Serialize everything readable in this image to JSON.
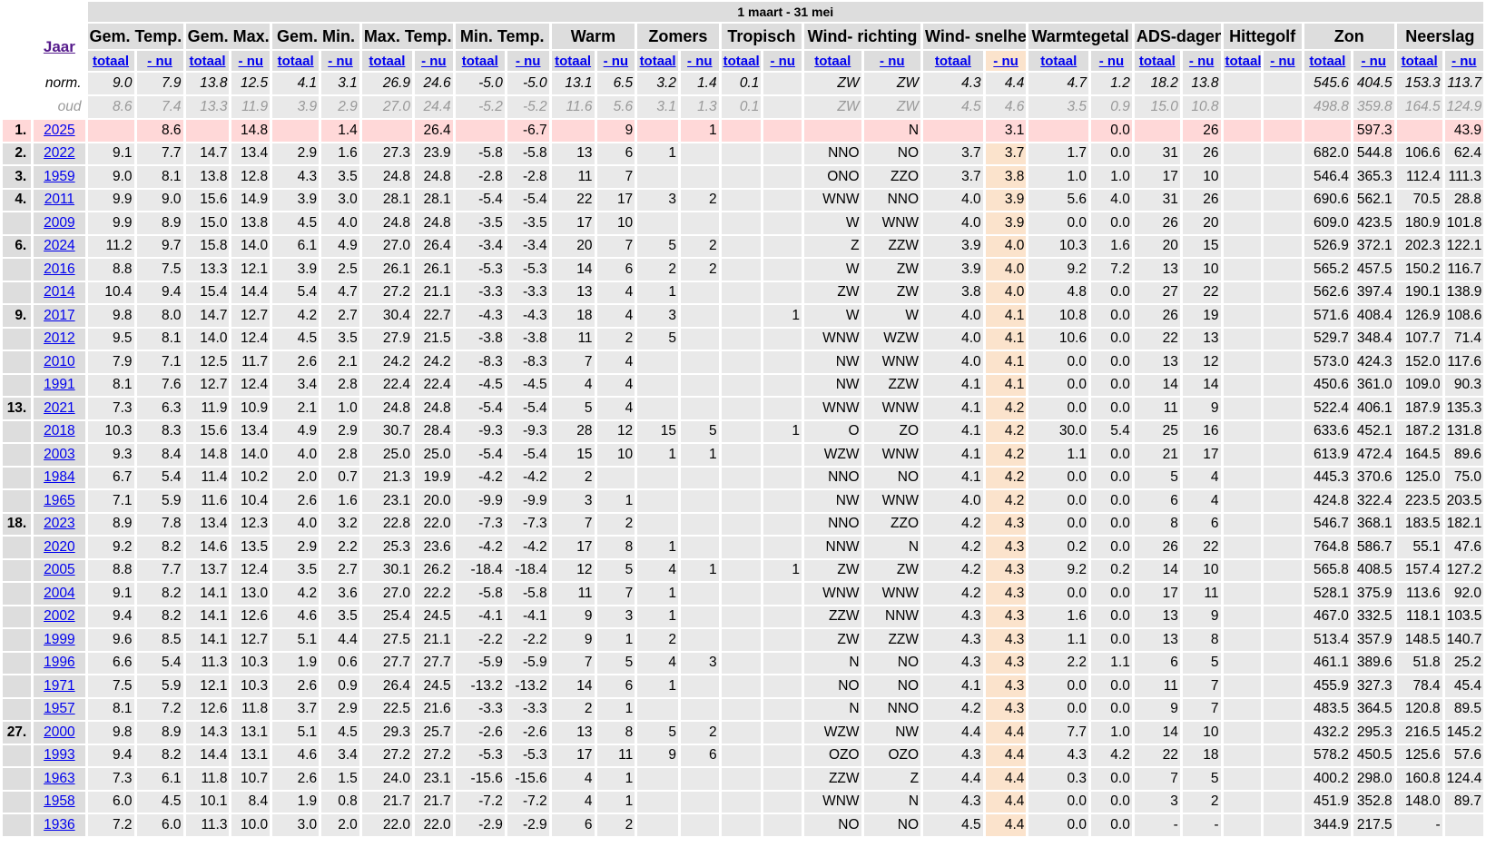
{
  "period": "1 maart - 31 mei",
  "jaar_label": "Jaar",
  "groups": [
    "Gem. Temp.",
    "Gem. Max.",
    "Gem. Min.",
    "Max. Temp.",
    "Min. Temp.",
    "Warm",
    "Zomers",
    "Tropisch",
    "Wind- richting",
    "Wind- snelheid",
    "Warmtegetal",
    "ADS-dagen",
    "Hittegolf",
    "Zon",
    "Neerslag"
  ],
  "sub_labels": [
    "totaal",
    "- nu"
  ],
  "highlight_col": 19,
  "norm": {
    "label": "norm.",
    "values": [
      "9.0",
      "7.9",
      "13.8",
      "12.5",
      "4.1",
      "3.1",
      "26.9",
      "24.6",
      "-5.0",
      "-5.0",
      "13.1",
      "6.5",
      "3.2",
      "1.4",
      "0.1",
      "",
      "ZW",
      "ZW",
      "4.3",
      "4.4",
      "4.7",
      "1.2",
      "18.2",
      "13.8",
      "",
      "",
      "545.6",
      "404.5",
      "153.3",
      "113.7"
    ]
  },
  "oud": {
    "label": "oud",
    "values": [
      "8.6",
      "7.4",
      "13.3",
      "11.9",
      "3.9",
      "2.9",
      "27.0",
      "24.4",
      "-5.2",
      "-5.2",
      "11.6",
      "5.6",
      "3.1",
      "1.3",
      "0.1",
      "",
      "ZW",
      "ZW",
      "4.5",
      "4.6",
      "3.5",
      "0.9",
      "15.0",
      "10.8",
      "",
      "",
      "498.8",
      "359.8",
      "164.5",
      "124.9"
    ]
  },
  "rows": [
    {
      "rank": "1.",
      "year": "2025",
      "current": true,
      "values": [
        "",
        "8.6",
        "",
        "14.8",
        "",
        "1.4",
        "",
        "26.4",
        "",
        "-6.7",
        "",
        "9",
        "",
        "1",
        "",
        "",
        "",
        "N",
        "",
        "3.1",
        "",
        "0.0",
        "",
        "26",
        "",
        "",
        "",
        "597.3",
        "",
        "43.9"
      ]
    },
    {
      "rank": "2.",
      "year": "2022",
      "values": [
        "9.1",
        "7.7",
        "14.7",
        "13.4",
        "2.9",
        "1.6",
        "27.3",
        "23.9",
        "-5.8",
        "-5.8",
        "13",
        "6",
        "1",
        "",
        "",
        "",
        "NNO",
        "NO",
        "3.7",
        "3.7",
        "1.7",
        "0.0",
        "31",
        "26",
        "",
        "",
        "682.0",
        "544.8",
        "106.6",
        "62.4"
      ]
    },
    {
      "rank": "3.",
      "year": "1959",
      "values": [
        "9.0",
        "8.1",
        "13.8",
        "12.8",
        "4.3",
        "3.5",
        "24.8",
        "24.8",
        "-2.8",
        "-2.8",
        "11",
        "7",
        "",
        "",
        "",
        "",
        "ONO",
        "ZZO",
        "3.7",
        "3.8",
        "1.0",
        "1.0",
        "17",
        "10",
        "",
        "",
        "546.4",
        "365.3",
        "112.4",
        "111.3"
      ]
    },
    {
      "rank": "4.",
      "year": "2011",
      "values": [
        "9.9",
        "9.0",
        "15.6",
        "14.9",
        "3.9",
        "3.0",
        "28.1",
        "28.1",
        "-5.4",
        "-5.4",
        "22",
        "17",
        "3",
        "2",
        "",
        "",
        "WNW",
        "NNO",
        "4.0",
        "3.9",
        "5.6",
        "4.0",
        "31",
        "26",
        "",
        "",
        "690.6",
        "562.1",
        "70.5",
        "28.8"
      ]
    },
    {
      "rank": "",
      "year": "2009",
      "values": [
        "9.9",
        "8.9",
        "15.0",
        "13.8",
        "4.5",
        "4.0",
        "24.8",
        "24.8",
        "-3.5",
        "-3.5",
        "17",
        "10",
        "",
        "",
        "",
        "",
        "W",
        "WNW",
        "4.0",
        "3.9",
        "0.0",
        "0.0",
        "26",
        "20",
        "",
        "",
        "609.0",
        "423.5",
        "180.9",
        "101.8"
      ]
    },
    {
      "rank": "6.",
      "year": "2024",
      "values": [
        "11.2",
        "9.7",
        "15.8",
        "14.0",
        "6.1",
        "4.9",
        "27.0",
        "26.4",
        "-3.4",
        "-3.4",
        "20",
        "7",
        "5",
        "2",
        "",
        "",
        "Z",
        "ZZW",
        "3.9",
        "4.0",
        "10.3",
        "1.6",
        "20",
        "15",
        "",
        "",
        "526.9",
        "372.1",
        "202.3",
        "122.1"
      ]
    },
    {
      "rank": "",
      "year": "2016",
      "values": [
        "8.8",
        "7.5",
        "13.3",
        "12.1",
        "3.9",
        "2.5",
        "26.1",
        "26.1",
        "-5.3",
        "-5.3",
        "14",
        "6",
        "2",
        "2",
        "",
        "",
        "W",
        "ZW",
        "3.9",
        "4.0",
        "9.2",
        "7.2",
        "13",
        "10",
        "",
        "",
        "565.2",
        "457.5",
        "150.2",
        "116.7"
      ]
    },
    {
      "rank": "",
      "year": "2014",
      "values": [
        "10.4",
        "9.4",
        "15.4",
        "14.4",
        "5.4",
        "4.7",
        "27.2",
        "21.1",
        "-3.3",
        "-3.3",
        "13",
        "4",
        "1",
        "",
        "",
        "",
        "ZW",
        "ZW",
        "3.8",
        "4.0",
        "4.8",
        "0.0",
        "27",
        "22",
        "",
        "",
        "562.6",
        "397.4",
        "190.1",
        "138.9"
      ]
    },
    {
      "rank": "9.",
      "year": "2017",
      "values": [
        "9.8",
        "8.0",
        "14.7",
        "12.7",
        "4.2",
        "2.7",
        "30.4",
        "22.7",
        "-4.3",
        "-4.3",
        "18",
        "4",
        "3",
        "",
        "",
        "1",
        "W",
        "W",
        "4.0",
        "4.1",
        "10.8",
        "0.0",
        "26",
        "19",
        "",
        "",
        "571.6",
        "408.4",
        "126.9",
        "108.6"
      ]
    },
    {
      "rank": "",
      "year": "2012",
      "values": [
        "9.5",
        "8.1",
        "14.0",
        "12.4",
        "4.5",
        "3.5",
        "27.9",
        "21.5",
        "-3.8",
        "-3.8",
        "11",
        "2",
        "5",
        "",
        "",
        "",
        "WNW",
        "WZW",
        "4.0",
        "4.1",
        "10.6",
        "0.0",
        "22",
        "13",
        "",
        "",
        "529.7",
        "348.4",
        "107.7",
        "71.4"
      ]
    },
    {
      "rank": "",
      "year": "2010",
      "values": [
        "7.9",
        "7.1",
        "12.5",
        "11.7",
        "2.6",
        "2.1",
        "24.2",
        "24.2",
        "-8.3",
        "-8.3",
        "7",
        "4",
        "",
        "",
        "",
        "",
        "NW",
        "WNW",
        "4.0",
        "4.1",
        "0.0",
        "0.0",
        "13",
        "12",
        "",
        "",
        "573.0",
        "424.3",
        "152.0",
        "117.6"
      ]
    },
    {
      "rank": "",
      "year": "1991",
      "values": [
        "8.1",
        "7.6",
        "12.7",
        "12.4",
        "3.4",
        "2.8",
        "22.4",
        "22.4",
        "-4.5",
        "-4.5",
        "4",
        "4",
        "",
        "",
        "",
        "",
        "NW",
        "ZZW",
        "4.1",
        "4.1",
        "0.0",
        "0.0",
        "14",
        "14",
        "",
        "",
        "450.6",
        "361.0",
        "109.0",
        "90.3"
      ]
    },
    {
      "rank": "13.",
      "year": "2021",
      "values": [
        "7.3",
        "6.3",
        "11.9",
        "10.9",
        "2.1",
        "1.0",
        "24.8",
        "24.8",
        "-5.4",
        "-5.4",
        "5",
        "4",
        "",
        "",
        "",
        "",
        "WNW",
        "WNW",
        "4.1",
        "4.2",
        "0.0",
        "0.0",
        "11",
        "9",
        "",
        "",
        "522.4",
        "406.1",
        "187.9",
        "135.3"
      ]
    },
    {
      "rank": "",
      "year": "2018",
      "values": [
        "10.3",
        "8.3",
        "15.6",
        "13.4",
        "4.9",
        "2.9",
        "30.7",
        "28.4",
        "-9.3",
        "-9.3",
        "28",
        "12",
        "15",
        "5",
        "",
        "1",
        "O",
        "ZO",
        "4.1",
        "4.2",
        "30.0",
        "5.4",
        "25",
        "16",
        "",
        "",
        "633.6",
        "452.1",
        "187.2",
        "131.8"
      ]
    },
    {
      "rank": "",
      "year": "2003",
      "values": [
        "9.3",
        "8.4",
        "14.8",
        "14.0",
        "4.0",
        "2.8",
        "25.0",
        "25.0",
        "-5.4",
        "-5.4",
        "15",
        "10",
        "1",
        "1",
        "",
        "",
        "WZW",
        "WNW",
        "4.1",
        "4.2",
        "1.1",
        "0.0",
        "21",
        "17",
        "",
        "",
        "613.9",
        "472.4",
        "164.5",
        "89.6"
      ]
    },
    {
      "rank": "",
      "year": "1984",
      "values": [
        "6.7",
        "5.4",
        "11.4",
        "10.2",
        "2.0",
        "0.7",
        "21.3",
        "19.9",
        "-4.2",
        "-4.2",
        "2",
        "",
        "",
        "",
        "",
        "",
        "NNO",
        "NO",
        "4.1",
        "4.2",
        "0.0",
        "0.0",
        "5",
        "4",
        "",
        "",
        "445.3",
        "370.6",
        "125.0",
        "75.0"
      ]
    },
    {
      "rank": "",
      "year": "1965",
      "values": [
        "7.1",
        "5.9",
        "11.6",
        "10.4",
        "2.6",
        "1.6",
        "23.1",
        "20.0",
        "-9.9",
        "-9.9",
        "3",
        "1",
        "",
        "",
        "",
        "",
        "NW",
        "WNW",
        "4.0",
        "4.2",
        "0.0",
        "0.0",
        "6",
        "4",
        "",
        "",
        "424.8",
        "322.4",
        "223.5",
        "203.5"
      ]
    },
    {
      "rank": "18.",
      "year": "2023",
      "values": [
        "8.9",
        "7.8",
        "13.4",
        "12.3",
        "4.0",
        "3.2",
        "22.8",
        "22.0",
        "-7.3",
        "-7.3",
        "7",
        "2",
        "",
        "",
        "",
        "",
        "NNO",
        "ZZO",
        "4.2",
        "4.3",
        "0.0",
        "0.0",
        "8",
        "6",
        "",
        "",
        "546.7",
        "368.1",
        "183.5",
        "182.1"
      ]
    },
    {
      "rank": "",
      "year": "2020",
      "values": [
        "9.2",
        "8.2",
        "14.6",
        "13.5",
        "2.9",
        "2.2",
        "25.3",
        "23.6",
        "-4.2",
        "-4.2",
        "17",
        "8",
        "1",
        "",
        "",
        "",
        "NNW",
        "N",
        "4.2",
        "4.3",
        "0.2",
        "0.0",
        "26",
        "22",
        "",
        "",
        "764.8",
        "586.7",
        "55.1",
        "47.6"
      ]
    },
    {
      "rank": "",
      "year": "2005",
      "values": [
        "8.8",
        "7.7",
        "13.7",
        "12.4",
        "3.5",
        "2.7",
        "30.1",
        "26.2",
        "-18.4",
        "-18.4",
        "12",
        "5",
        "4",
        "1",
        "",
        "1",
        "ZW",
        "ZW",
        "4.2",
        "4.3",
        "9.2",
        "0.2",
        "14",
        "10",
        "",
        "",
        "565.8",
        "408.5",
        "157.4",
        "127.2"
      ]
    },
    {
      "rank": "",
      "year": "2004",
      "values": [
        "9.1",
        "8.2",
        "14.1",
        "13.0",
        "4.2",
        "3.6",
        "27.0",
        "22.2",
        "-5.8",
        "-5.8",
        "11",
        "7",
        "1",
        "",
        "",
        "",
        "WNW",
        "WNW",
        "4.2",
        "4.3",
        "0.0",
        "0.0",
        "17",
        "11",
        "",
        "",
        "528.1",
        "375.9",
        "113.6",
        "92.0"
      ]
    },
    {
      "rank": "",
      "year": "2002",
      "values": [
        "9.4",
        "8.2",
        "14.1",
        "12.6",
        "4.6",
        "3.5",
        "25.4",
        "24.5",
        "-4.1",
        "-4.1",
        "9",
        "3",
        "1",
        "",
        "",
        "",
        "ZZW",
        "NNW",
        "4.3",
        "4.3",
        "1.6",
        "0.0",
        "13",
        "9",
        "",
        "",
        "467.0",
        "332.5",
        "118.1",
        "103.5"
      ]
    },
    {
      "rank": "",
      "year": "1999",
      "values": [
        "9.6",
        "8.5",
        "14.1",
        "12.7",
        "5.1",
        "4.4",
        "27.5",
        "21.1",
        "-2.2",
        "-2.2",
        "9",
        "1",
        "2",
        "",
        "",
        "",
        "ZW",
        "ZZW",
        "4.3",
        "4.3",
        "1.1",
        "0.0",
        "13",
        "8",
        "",
        "",
        "513.4",
        "357.9",
        "148.5",
        "140.7"
      ]
    },
    {
      "rank": "",
      "year": "1996",
      "values": [
        "6.6",
        "5.4",
        "11.3",
        "10.3",
        "1.9",
        "0.6",
        "27.7",
        "27.7",
        "-5.9",
        "-5.9",
        "7",
        "5",
        "4",
        "3",
        "",
        "",
        "N",
        "NO",
        "4.3",
        "4.3",
        "2.2",
        "1.1",
        "6",
        "5",
        "",
        "",
        "461.1",
        "389.6",
        "51.8",
        "25.2"
      ]
    },
    {
      "rank": "",
      "year": "1971",
      "values": [
        "7.5",
        "5.9",
        "12.1",
        "10.3",
        "2.6",
        "0.9",
        "26.4",
        "24.5",
        "-13.2",
        "-13.2",
        "14",
        "6",
        "1",
        "",
        "",
        "",
        "NO",
        "NO",
        "4.1",
        "4.3",
        "0.0",
        "0.0",
        "11",
        "7",
        "",
        "",
        "455.9",
        "327.3",
        "78.4",
        "45.4"
      ]
    },
    {
      "rank": "",
      "year": "1957",
      "values": [
        "8.1",
        "7.2",
        "12.6",
        "11.8",
        "3.7",
        "2.9",
        "22.5",
        "21.6",
        "-3.3",
        "-3.3",
        "2",
        "1",
        "",
        "",
        "",
        "",
        "N",
        "NNO",
        "4.2",
        "4.3",
        "0.0",
        "0.0",
        "9",
        "7",
        "",
        "",
        "483.5",
        "364.5",
        "120.8",
        "89.5"
      ]
    },
    {
      "rank": "27.",
      "year": "2000",
      "values": [
        "9.8",
        "8.9",
        "14.3",
        "13.1",
        "5.1",
        "4.5",
        "29.3",
        "25.7",
        "-2.6",
        "-2.6",
        "13",
        "8",
        "5",
        "2",
        "",
        "",
        "WZW",
        "NW",
        "4.4",
        "4.4",
        "7.7",
        "1.0",
        "14",
        "10",
        "",
        "",
        "432.2",
        "295.3",
        "216.5",
        "145.2"
      ]
    },
    {
      "rank": "",
      "year": "1993",
      "values": [
        "9.4",
        "8.2",
        "14.4",
        "13.1",
        "4.6",
        "3.4",
        "27.2",
        "27.2",
        "-5.3",
        "-5.3",
        "17",
        "11",
        "9",
        "6",
        "",
        "",
        "OZO",
        "OZO",
        "4.3",
        "4.4",
        "4.3",
        "4.2",
        "22",
        "18",
        "",
        "",
        "578.2",
        "450.5",
        "125.6",
        "57.6"
      ]
    },
    {
      "rank": "",
      "year": "1963",
      "values": [
        "7.3",
        "6.1",
        "11.8",
        "10.7",
        "2.6",
        "1.5",
        "24.0",
        "23.1",
        "-15.6",
        "-15.6",
        "4",
        "1",
        "",
        "",
        "",
        "",
        "ZZW",
        "Z",
        "4.4",
        "4.4",
        "0.3",
        "0.0",
        "7",
        "5",
        "",
        "",
        "400.2",
        "298.0",
        "160.8",
        "124.4"
      ]
    },
    {
      "rank": "",
      "year": "1958",
      "values": [
        "6.0",
        "4.5",
        "10.1",
        "8.4",
        "1.9",
        "0.8",
        "21.7",
        "21.7",
        "-7.2",
        "-7.2",
        "4",
        "1",
        "",
        "",
        "",
        "",
        "WNW",
        "N",
        "4.3",
        "4.4",
        "0.0",
        "0.0",
        "3",
        "2",
        "",
        "",
        "451.9",
        "352.8",
        "148.0",
        "89.7"
      ]
    },
    {
      "rank": "",
      "year": "1936",
      "values": [
        "7.2",
        "6.0",
        "11.3",
        "10.0",
        "3.0",
        "2.0",
        "22.0",
        "22.0",
        "-2.9",
        "-2.9",
        "6",
        "2",
        "",
        "",
        "",
        "",
        "NO",
        "NO",
        "4.5",
        "4.4",
        "0.0",
        "0.0",
        "-",
        "-",
        "",
        "",
        "344.9",
        "217.5",
        "-",
        ""
      ]
    }
  ]
}
